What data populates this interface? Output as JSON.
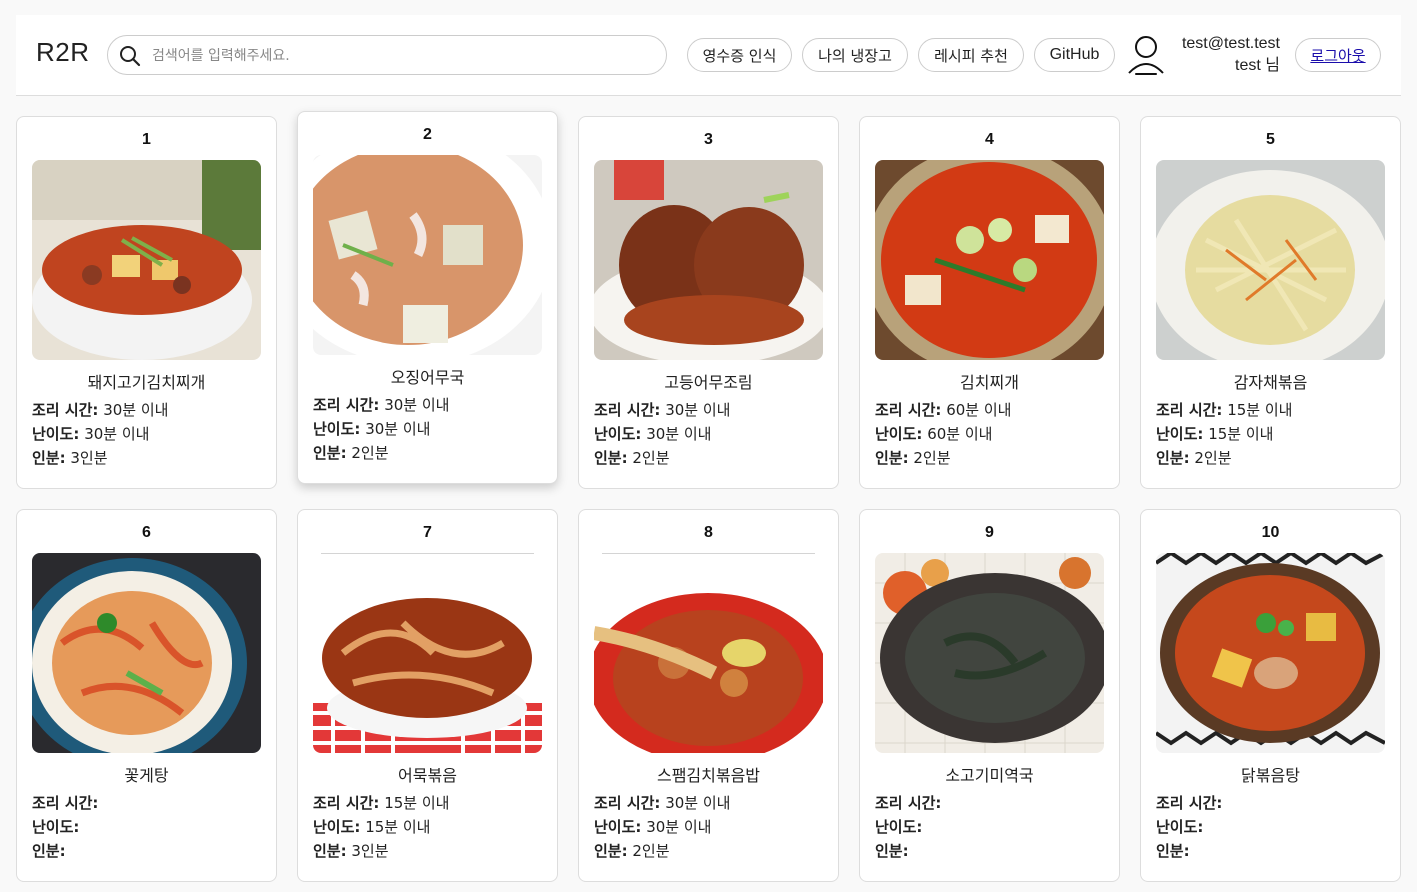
{
  "header": {
    "logo": "R2R",
    "search_placeholder": "검색어를 입력해주세요.",
    "nav": {
      "receipt": "영수증 인식",
      "fridge": "나의 냉장고",
      "recommend": "레시피 추천",
      "github": "GitHub"
    },
    "user_email": "test@test.test",
    "user_name": "test 님",
    "logout": "로그아웃"
  },
  "labels": {
    "time": "조리 시간:",
    "difficulty": "난이도:",
    "servings": "인분:"
  },
  "recipes": [
    {
      "num": "1",
      "name": "돼지고기김치찌개",
      "time": "30분 이내",
      "difficulty": "30분 이내",
      "servings": "3인분"
    },
    {
      "num": "2",
      "name": "오징어무국",
      "time": "30분 이내",
      "difficulty": "30분 이내",
      "servings": "2인분"
    },
    {
      "num": "3",
      "name": "고등어무조림",
      "time": "30분 이내",
      "difficulty": "30분 이내",
      "servings": "2인분"
    },
    {
      "num": "4",
      "name": "김치찌개",
      "time": "60분 이내",
      "difficulty": "60분 이내",
      "servings": "2인분"
    },
    {
      "num": "5",
      "name": "감자채볶음",
      "time": "15분 이내",
      "difficulty": "15분 이내",
      "servings": "2인분"
    },
    {
      "num": "6",
      "name": "꽃게탕",
      "time": "",
      "difficulty": "",
      "servings": ""
    },
    {
      "num": "7",
      "name": "어묵볶음",
      "time": "15분 이내",
      "difficulty": "15분 이내",
      "servings": "3인분"
    },
    {
      "num": "8",
      "name": "스팸김치볶음밥",
      "time": "30분 이내",
      "difficulty": "30분 이내",
      "servings": "2인분"
    },
    {
      "num": "9",
      "name": "소고기미역국",
      "time": "",
      "difficulty": "",
      "servings": ""
    },
    {
      "num": "10",
      "name": "닭볶음탕",
      "time": "",
      "difficulty": "",
      "servings": ""
    }
  ],
  "colors": {
    "link": "#1a0dab",
    "border": "#cccccc"
  }
}
